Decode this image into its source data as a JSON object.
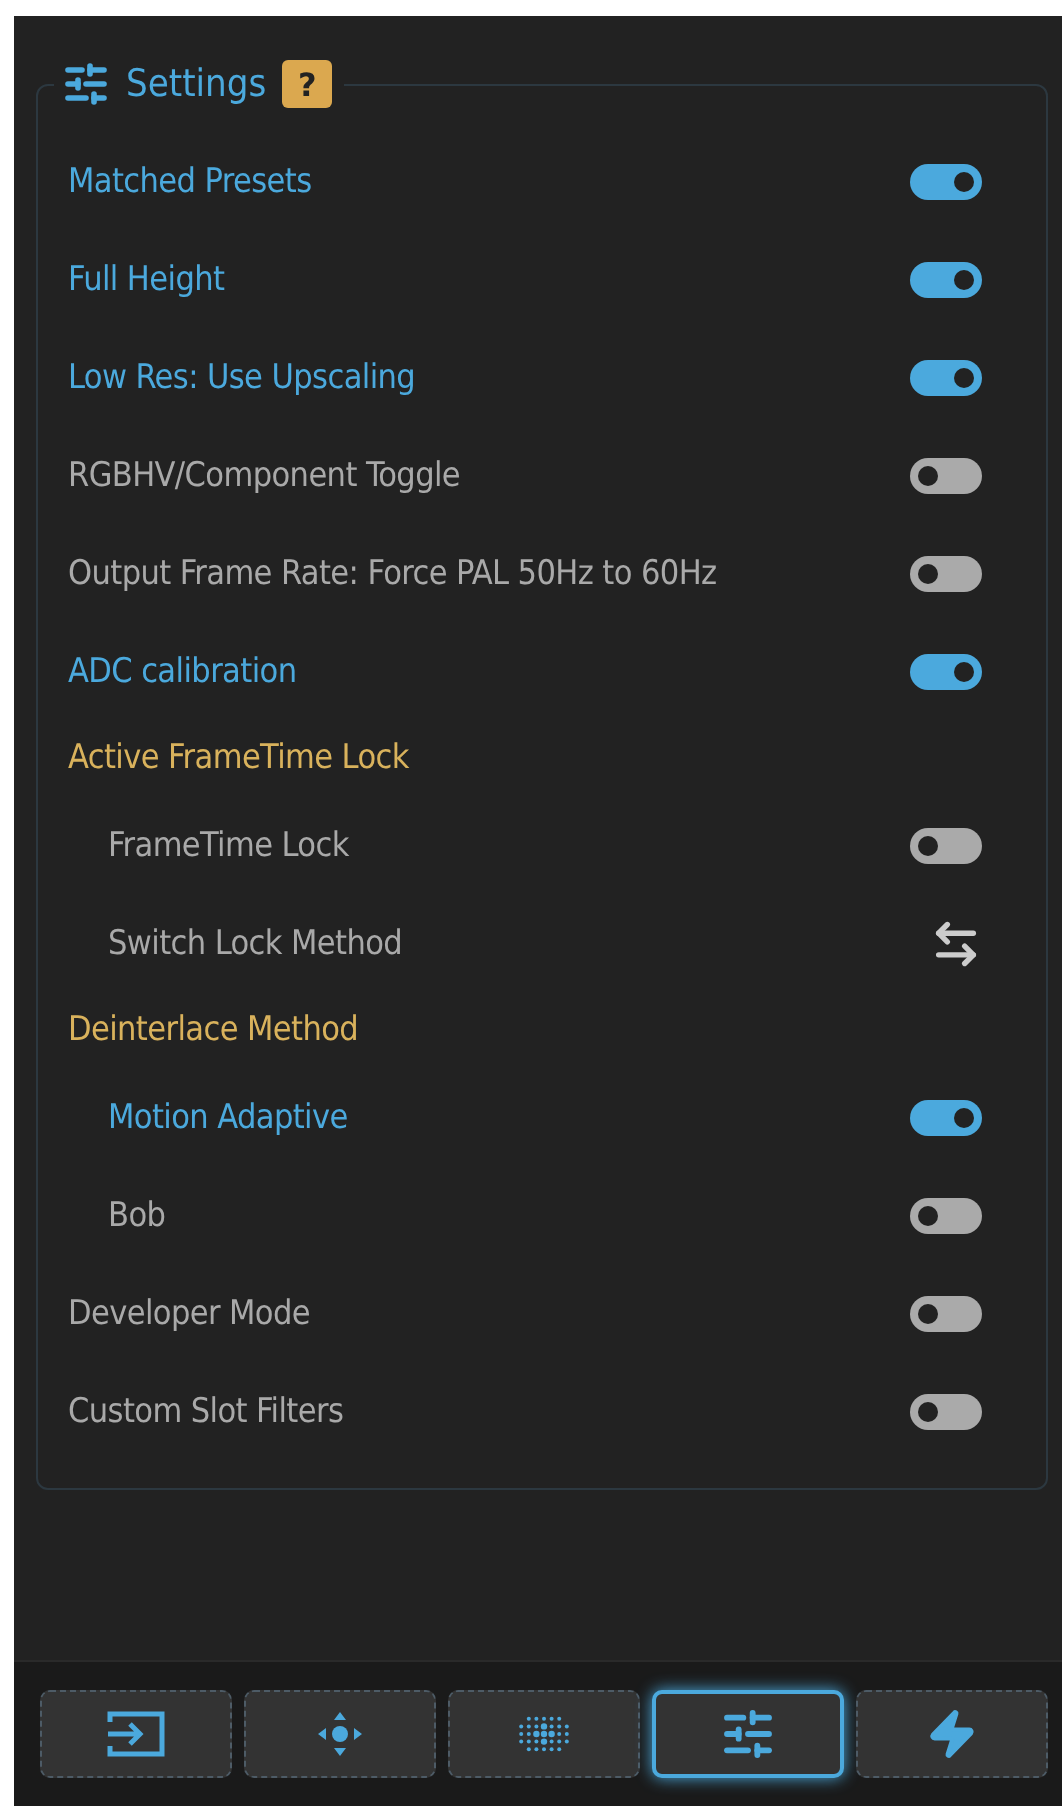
{
  "panel": {
    "title": "Settings",
    "help": "?"
  },
  "items": [
    {
      "kind": "toggle",
      "label": "Matched Presets",
      "on": true
    },
    {
      "kind": "toggle",
      "label": "Full Height",
      "on": true
    },
    {
      "kind": "toggle",
      "label": "Low Res: Use Upscaling",
      "on": true
    },
    {
      "kind": "toggle",
      "label": "RGBHV/Component Toggle",
      "on": false
    },
    {
      "kind": "toggle",
      "label": "Output Frame Rate: Force PAL 50Hz to 60Hz",
      "on": false
    },
    {
      "kind": "toggle",
      "label": "ADC calibration",
      "on": true
    },
    {
      "kind": "heading",
      "label": "Active FrameTime Lock",
      "children": [
        {
          "kind": "toggle",
          "label": "FrameTime Lock",
          "on": false
        },
        {
          "kind": "action",
          "label": "Switch Lock Method"
        }
      ]
    },
    {
      "kind": "heading",
      "label": "Deinterlace Method",
      "children": [
        {
          "kind": "toggle",
          "label": "Motion Adaptive",
          "on": true
        },
        {
          "kind": "toggle",
          "label": "Bob",
          "on": false
        }
      ]
    },
    {
      "kind": "toggle",
      "label": "Developer Mode",
      "on": false
    },
    {
      "kind": "toggle",
      "label": "Custom Slot Filters",
      "on": false
    }
  ],
  "nav": [
    {
      "kind": "input",
      "selected": false
    },
    {
      "kind": "move",
      "selected": false
    },
    {
      "kind": "dots",
      "selected": false
    },
    {
      "kind": "sliders",
      "selected": true
    },
    {
      "kind": "power",
      "selected": false
    }
  ]
}
